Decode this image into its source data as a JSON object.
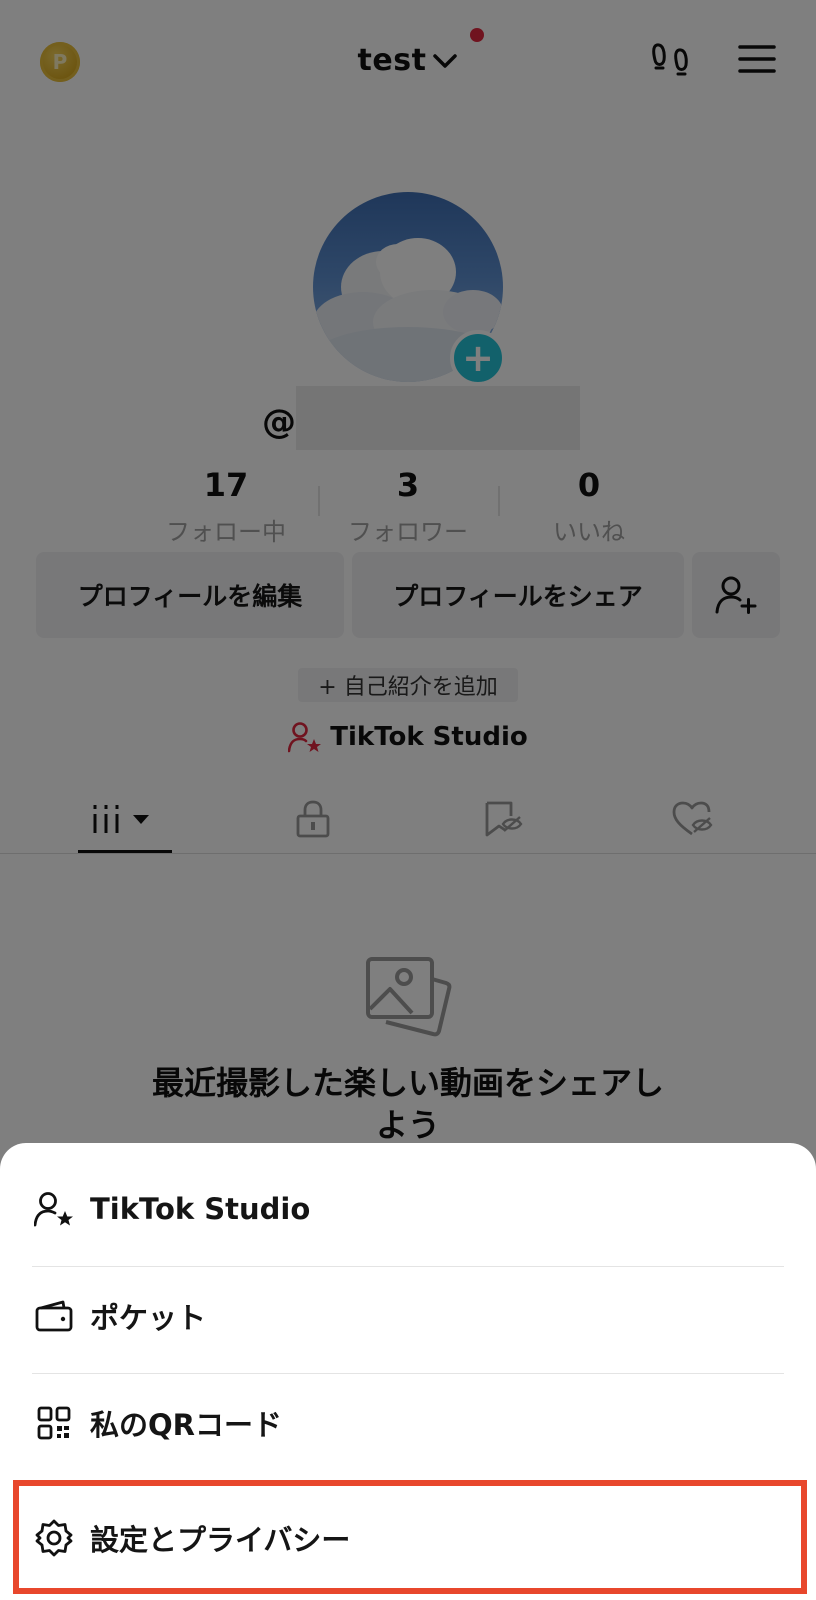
{
  "header": {
    "coin_glyph": "P",
    "username": "test",
    "icons": [
      "coin-icon",
      "chevron-down-icon",
      "footprints-icon",
      "hamburger-menu-icon"
    ],
    "notification_color": "#e0263e"
  },
  "profile": {
    "at_sign": "@",
    "add_avatar_glyph": "+",
    "stats": [
      {
        "value": "17",
        "label": "フォロー中"
      },
      {
        "value": "3",
        "label": "フォロワー"
      },
      {
        "value": "0",
        "label": "いいね"
      }
    ],
    "buttons": {
      "edit": "プロフィールを編集",
      "share": "プロフィールをシェア"
    },
    "add_bio": "+ 自己紹介を追加",
    "studio_link": "TikTok Studio"
  },
  "tabs": [
    "videos-tab",
    "private-tab",
    "saved-tab",
    "liked-tab"
  ],
  "empty_state": {
    "text": "最近撮影した楽しい動画をシェアしよう"
  },
  "sheet": {
    "items": [
      {
        "label": "TikTok Studio",
        "icon": "person-star-icon"
      },
      {
        "label": "ポケット",
        "icon": "wallet-icon"
      },
      {
        "label": "私のQRコード",
        "icon": "qr-code-icon"
      },
      {
        "label": "設定とプライバシー",
        "icon": "gear-icon"
      }
    ],
    "highlight_color": "#e8472c"
  },
  "colors": {
    "accent_teal": "#25c3d6",
    "studio_icon_red": "#e0263e"
  }
}
